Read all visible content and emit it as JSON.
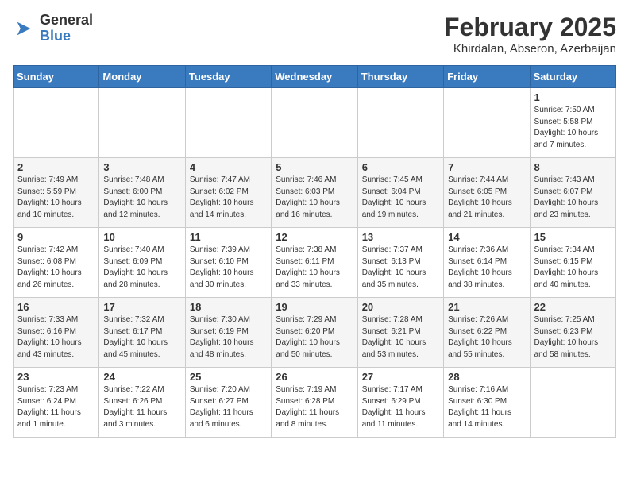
{
  "header": {
    "logo": {
      "general": "General",
      "blue": "Blue"
    },
    "title": "February 2025",
    "subtitle": "Khirdalan, Abseron, Azerbaijan"
  },
  "calendar": {
    "weekdays": [
      "Sunday",
      "Monday",
      "Tuesday",
      "Wednesday",
      "Thursday",
      "Friday",
      "Saturday"
    ],
    "weeks": [
      [
        {
          "day": "",
          "info": ""
        },
        {
          "day": "",
          "info": ""
        },
        {
          "day": "",
          "info": ""
        },
        {
          "day": "",
          "info": ""
        },
        {
          "day": "",
          "info": ""
        },
        {
          "day": "",
          "info": ""
        },
        {
          "day": "1",
          "info": "Sunrise: 7:50 AM\nSunset: 5:58 PM\nDaylight: 10 hours and 7 minutes."
        }
      ],
      [
        {
          "day": "2",
          "info": "Sunrise: 7:49 AM\nSunset: 5:59 PM\nDaylight: 10 hours and 10 minutes."
        },
        {
          "day": "3",
          "info": "Sunrise: 7:48 AM\nSunset: 6:00 PM\nDaylight: 10 hours and 12 minutes."
        },
        {
          "day": "4",
          "info": "Sunrise: 7:47 AM\nSunset: 6:02 PM\nDaylight: 10 hours and 14 minutes."
        },
        {
          "day": "5",
          "info": "Sunrise: 7:46 AM\nSunset: 6:03 PM\nDaylight: 10 hours and 16 minutes."
        },
        {
          "day": "6",
          "info": "Sunrise: 7:45 AM\nSunset: 6:04 PM\nDaylight: 10 hours and 19 minutes."
        },
        {
          "day": "7",
          "info": "Sunrise: 7:44 AM\nSunset: 6:05 PM\nDaylight: 10 hours and 21 minutes."
        },
        {
          "day": "8",
          "info": "Sunrise: 7:43 AM\nSunset: 6:07 PM\nDaylight: 10 hours and 23 minutes."
        }
      ],
      [
        {
          "day": "9",
          "info": "Sunrise: 7:42 AM\nSunset: 6:08 PM\nDaylight: 10 hours and 26 minutes."
        },
        {
          "day": "10",
          "info": "Sunrise: 7:40 AM\nSunset: 6:09 PM\nDaylight: 10 hours and 28 minutes."
        },
        {
          "day": "11",
          "info": "Sunrise: 7:39 AM\nSunset: 6:10 PM\nDaylight: 10 hours and 30 minutes."
        },
        {
          "day": "12",
          "info": "Sunrise: 7:38 AM\nSunset: 6:11 PM\nDaylight: 10 hours and 33 minutes."
        },
        {
          "day": "13",
          "info": "Sunrise: 7:37 AM\nSunset: 6:13 PM\nDaylight: 10 hours and 35 minutes."
        },
        {
          "day": "14",
          "info": "Sunrise: 7:36 AM\nSunset: 6:14 PM\nDaylight: 10 hours and 38 minutes."
        },
        {
          "day": "15",
          "info": "Sunrise: 7:34 AM\nSunset: 6:15 PM\nDaylight: 10 hours and 40 minutes."
        }
      ],
      [
        {
          "day": "16",
          "info": "Sunrise: 7:33 AM\nSunset: 6:16 PM\nDaylight: 10 hours and 43 minutes."
        },
        {
          "day": "17",
          "info": "Sunrise: 7:32 AM\nSunset: 6:17 PM\nDaylight: 10 hours and 45 minutes."
        },
        {
          "day": "18",
          "info": "Sunrise: 7:30 AM\nSunset: 6:19 PM\nDaylight: 10 hours and 48 minutes."
        },
        {
          "day": "19",
          "info": "Sunrise: 7:29 AM\nSunset: 6:20 PM\nDaylight: 10 hours and 50 minutes."
        },
        {
          "day": "20",
          "info": "Sunrise: 7:28 AM\nSunset: 6:21 PM\nDaylight: 10 hours and 53 minutes."
        },
        {
          "day": "21",
          "info": "Sunrise: 7:26 AM\nSunset: 6:22 PM\nDaylight: 10 hours and 55 minutes."
        },
        {
          "day": "22",
          "info": "Sunrise: 7:25 AM\nSunset: 6:23 PM\nDaylight: 10 hours and 58 minutes."
        }
      ],
      [
        {
          "day": "23",
          "info": "Sunrise: 7:23 AM\nSunset: 6:24 PM\nDaylight: 11 hours and 1 minute."
        },
        {
          "day": "24",
          "info": "Sunrise: 7:22 AM\nSunset: 6:26 PM\nDaylight: 11 hours and 3 minutes."
        },
        {
          "day": "25",
          "info": "Sunrise: 7:20 AM\nSunset: 6:27 PM\nDaylight: 11 hours and 6 minutes."
        },
        {
          "day": "26",
          "info": "Sunrise: 7:19 AM\nSunset: 6:28 PM\nDaylight: 11 hours and 8 minutes."
        },
        {
          "day": "27",
          "info": "Sunrise: 7:17 AM\nSunset: 6:29 PM\nDaylight: 11 hours and 11 minutes."
        },
        {
          "day": "28",
          "info": "Sunrise: 7:16 AM\nSunset: 6:30 PM\nDaylight: 11 hours and 14 minutes."
        },
        {
          "day": "",
          "info": ""
        }
      ]
    ]
  }
}
